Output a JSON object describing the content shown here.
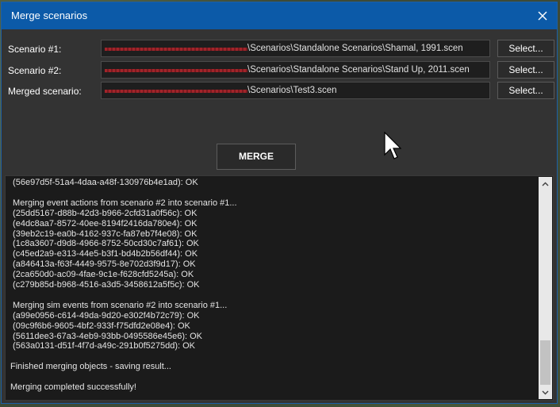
{
  "window": {
    "title": "Merge scenarios",
    "close_glyph": "✕"
  },
  "fields": [
    {
      "label": "Scenario #1:",
      "path": "\\Scenarios\\Standalone Scenarios\\Shamal, 1991.scen",
      "button": "Select..."
    },
    {
      "label": "Scenario #2:",
      "path": "\\Scenarios\\Standalone Scenarios\\Stand Up, 2011.scen",
      "button": "Select..."
    },
    {
      "label": "Merged scenario:",
      "path": "\\Scenarios\\Test3.scen",
      "button": "Select..."
    }
  ],
  "merge_button": "MERGE",
  "log": [
    " (56e97d5f-51a4-4daa-a48f-130976b4e1ad): OK",
    "",
    " Merging event actions from scenario #2 into scenario #1...",
    " (25dd5167-d88b-42d3-b966-2cfd31a0f56c): OK",
    " (e4dc8aa7-8572-40ee-8194f2416da780e4): OK",
    " (39eb2c19-ea0b-4162-937c-fa87eb7f4e08): OK",
    " (1c8a3607-d9d8-4966-8752-50cd30c7af61): OK",
    " (c45ed2a9-e313-44e5-b3f1-bd4b2b56df44): OK",
    " (a846413a-f63f-4449-9575-8e702d3f9d17): OK",
    " (2ca650d0-ac09-4fae-9c1e-f628cfd5245a): OK",
    " (c279b85d-b968-4516-a3d5-3458612a5f5c): OK",
    "",
    " Merging sim events from scenario #2 into scenario #1...",
    " (a99e0956-c614-49da-9d20-e302f4b72c79): OK",
    " (09c9f6b6-9605-4bf2-933f-f75dfd2e08e4): OK",
    " (5611dee3-67a3-4eb9-93bb-0495586e45e6): OK",
    " (563a0131-d51f-4f7d-a49c-291b0f5275dd): OK",
    "",
    "Finished merging objects - saving result...",
    "",
    "Merging completed successfully!"
  ],
  "scrollbar": {
    "up_glyph": "▲",
    "down_glyph": "▼"
  },
  "colors": {
    "titlebar": "#0c5aa8",
    "window_bg": "#333333",
    "log_bg": "#1b1b1b",
    "redaction": "#a1242a"
  },
  "icons": [
    "close-icon",
    "mouse-cursor-icon",
    "scroll-up-icon",
    "scroll-down-icon"
  ]
}
